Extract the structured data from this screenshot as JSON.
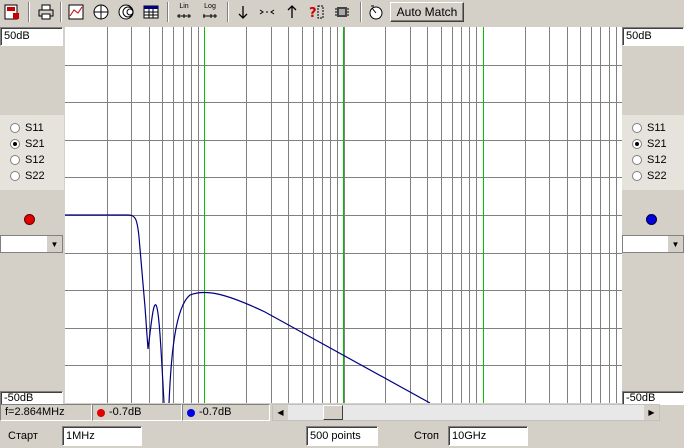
{
  "toolbar": {
    "auto_match_label": "Auto Match",
    "lin_label": "Lin",
    "log_label": "Log"
  },
  "left_panel": {
    "top_value": "50dB",
    "bottom_value": "-50dB",
    "radios": [
      {
        "label": "S11",
        "selected": false
      },
      {
        "label": "S21",
        "selected": true
      },
      {
        "label": "S12",
        "selected": false
      },
      {
        "label": "S22",
        "selected": false
      }
    ],
    "marker_color": "#e00000"
  },
  "right_panel": {
    "top_value": "50dB",
    "bottom_value": "-50dB",
    "radios": [
      {
        "label": "S11",
        "selected": false
      },
      {
        "label": "S21",
        "selected": true
      },
      {
        "label": "S12",
        "selected": false
      },
      {
        "label": "S22",
        "selected": false
      }
    ],
    "marker_color": "#0000e0"
  },
  "plot": {
    "grid_color": "#808080",
    "marker_line_color": "#00c000",
    "trace_color": "#000080"
  },
  "status": {
    "frequency": "f=2.864MHz",
    "marker1_value": "-0.7dB",
    "marker2_value": "-0.7dB"
  },
  "sweep": {
    "start_label": "Старт",
    "start_value": "1MHz",
    "points_value": "500 points",
    "stop_label": "Стоп",
    "stop_value": "10GHz"
  }
}
